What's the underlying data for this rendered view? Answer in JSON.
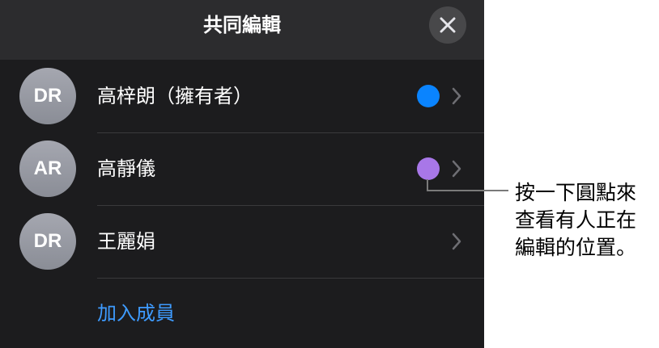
{
  "header": {
    "title": "共同編輯"
  },
  "close_icon": "close-icon",
  "members": [
    {
      "initials": "DR",
      "name": "高梓朗（擁有者）",
      "dot_color": "#0a84ff",
      "has_dot": true
    },
    {
      "initials": "AR",
      "name": "高靜儀",
      "dot_color": "#a877e8",
      "has_dot": true
    },
    {
      "initials": "DR",
      "name": "王麗娟",
      "dot_color": "",
      "has_dot": false
    }
  ],
  "add_member_label": "加入成員",
  "callout": {
    "text": "按一下圓點來\n查看有人正在\n編輯的位置。"
  },
  "colors": {
    "accent": "#3e9bff",
    "panel": "#1c1c1e",
    "header": "#2c2c2e"
  }
}
